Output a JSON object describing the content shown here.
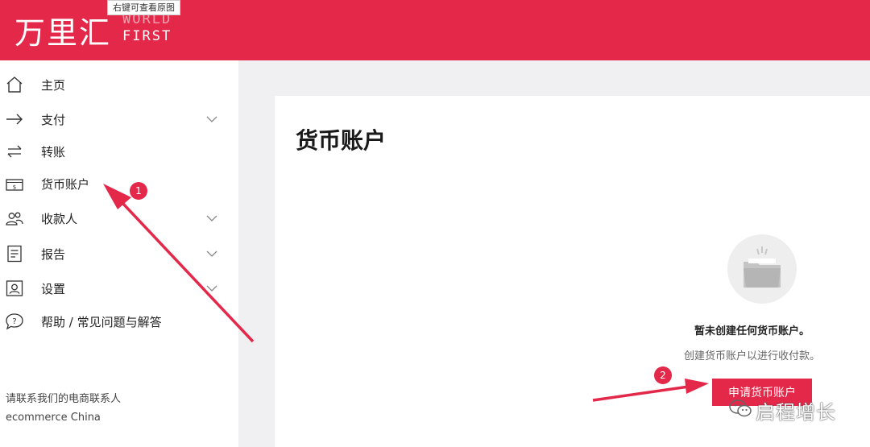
{
  "header": {
    "logo_cn": "万里汇",
    "logo_en_line1": "WORLD",
    "logo_en_line2": "FIRST",
    "brand_color": "#e4284a",
    "tooltip": "右键可查看原图"
  },
  "sidebar": {
    "items": [
      {
        "label": "主页",
        "icon": "home-icon",
        "has_chevron": false
      },
      {
        "label": "支付",
        "icon": "arrow-right-icon",
        "has_chevron": true
      },
      {
        "label": "转账",
        "icon": "transfer-icon",
        "has_chevron": false
      },
      {
        "label": "货币账户",
        "icon": "currency-account-icon",
        "has_chevron": false
      },
      {
        "label": "收款人",
        "icon": "people-icon",
        "has_chevron": true
      },
      {
        "label": "报告",
        "icon": "report-icon",
        "has_chevron": true
      },
      {
        "label": "设置",
        "icon": "settings-icon",
        "has_chevron": true
      },
      {
        "label": "帮助 / 常见问题与解答",
        "icon": "help-icon",
        "has_chevron": false
      }
    ],
    "contact_line1": "请联系我们的电商联系人",
    "contact_line2": "ecommerce China"
  },
  "main": {
    "title": "货币账户",
    "empty_icon": "folder-icon",
    "empty_title": "暂未创建任何货币账户。",
    "empty_subtitle": "创建货币账户以进行收付款。",
    "apply_button": "申请货币账户"
  },
  "annotations": {
    "badge_1": "1",
    "badge_2": "2",
    "arrow_color": "#e4284a"
  },
  "watermark": {
    "text": "启程增长",
    "icon": "wechat-icon"
  }
}
